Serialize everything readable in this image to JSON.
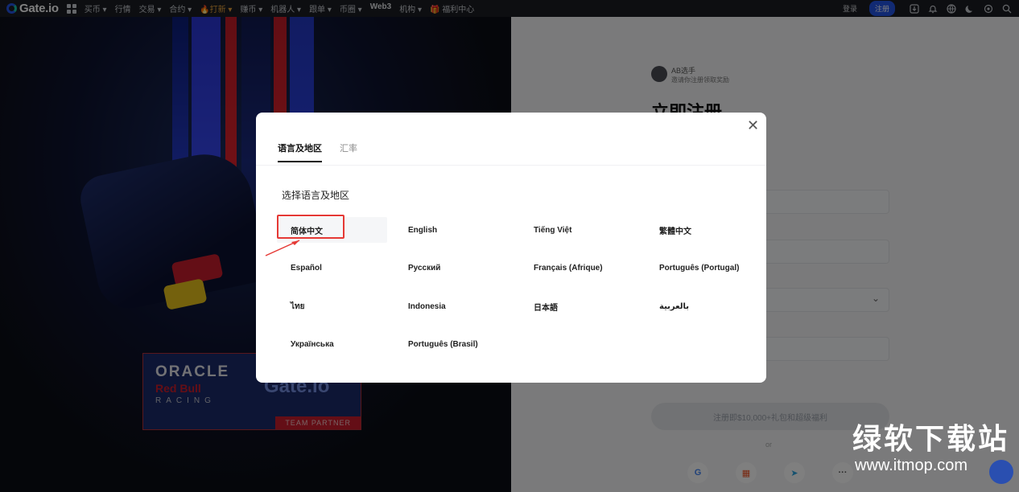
{
  "topnav": {
    "logo": "Gate.io",
    "items": [
      {
        "label": "买币 ▾",
        "style": ""
      },
      {
        "label": "行情",
        "style": ""
      },
      {
        "label": "交易 ▾",
        "style": ""
      },
      {
        "label": "合约 ▾",
        "style": ""
      },
      {
        "label": "🔥打新 ▾",
        "style": "hot"
      },
      {
        "label": "赚币 ▾",
        "style": ""
      },
      {
        "label": "机器人 ▾",
        "style": ""
      },
      {
        "label": "跟单 ▾",
        "style": ""
      },
      {
        "label": "币圈 ▾",
        "style": ""
      },
      {
        "label": "Web3",
        "style": "strong"
      },
      {
        "label": "机构 ▾",
        "style": ""
      },
      {
        "label": "🎁 福利中心",
        "style": ""
      }
    ],
    "login": "登录",
    "register": "注册",
    "icons": [
      "download-icon",
      "bell-icon",
      "globe-icon",
      "theme-icon",
      "settings-icon",
      "search-icon"
    ]
  },
  "promo": {
    "partner": {
      "oracle": "ORACLE",
      "redbull": "Red Bull",
      "racing": "RACING",
      "gate": "Gate.io",
      "team": "TEAM PARTNER"
    }
  },
  "register": {
    "referrer_name": "AB选手",
    "referrer_note": "邀请你注册领取奖励",
    "title": "立即注册",
    "cta": "注册即$10,000+礼包和超级福利",
    "or": "or",
    "social": [
      "G",
      "▦",
      "➤",
      "···"
    ]
  },
  "modal": {
    "tabs": [
      {
        "label": "语言及地区",
        "active": true
      },
      {
        "label": "汇率",
        "active": false
      }
    ],
    "section_title": "选择语言及地区",
    "languages": [
      {
        "label": "简体中文",
        "selected": true
      },
      {
        "label": "English",
        "selected": false
      },
      {
        "label": "Tiếng Việt",
        "selected": false
      },
      {
        "label": "繁體中文",
        "selected": false
      },
      {
        "label": "Español",
        "selected": false
      },
      {
        "label": "Русский",
        "selected": false
      },
      {
        "label": "Français (Afrique)",
        "selected": false
      },
      {
        "label": "Português (Portugal)",
        "selected": false
      },
      {
        "label": "ไทย",
        "selected": false
      },
      {
        "label": "Indonesia",
        "selected": false
      },
      {
        "label": "日本語",
        "selected": false
      },
      {
        "label": "بالعربية",
        "selected": false
      },
      {
        "label": "Українська",
        "selected": false
      },
      {
        "label": "Português (Brasil)",
        "selected": false
      }
    ]
  },
  "watermark": {
    "title": "绿软下载站",
    "url": "www.itmop.com"
  },
  "colors": {
    "accent": "#2354e6",
    "highlight_red": "#e53935"
  }
}
